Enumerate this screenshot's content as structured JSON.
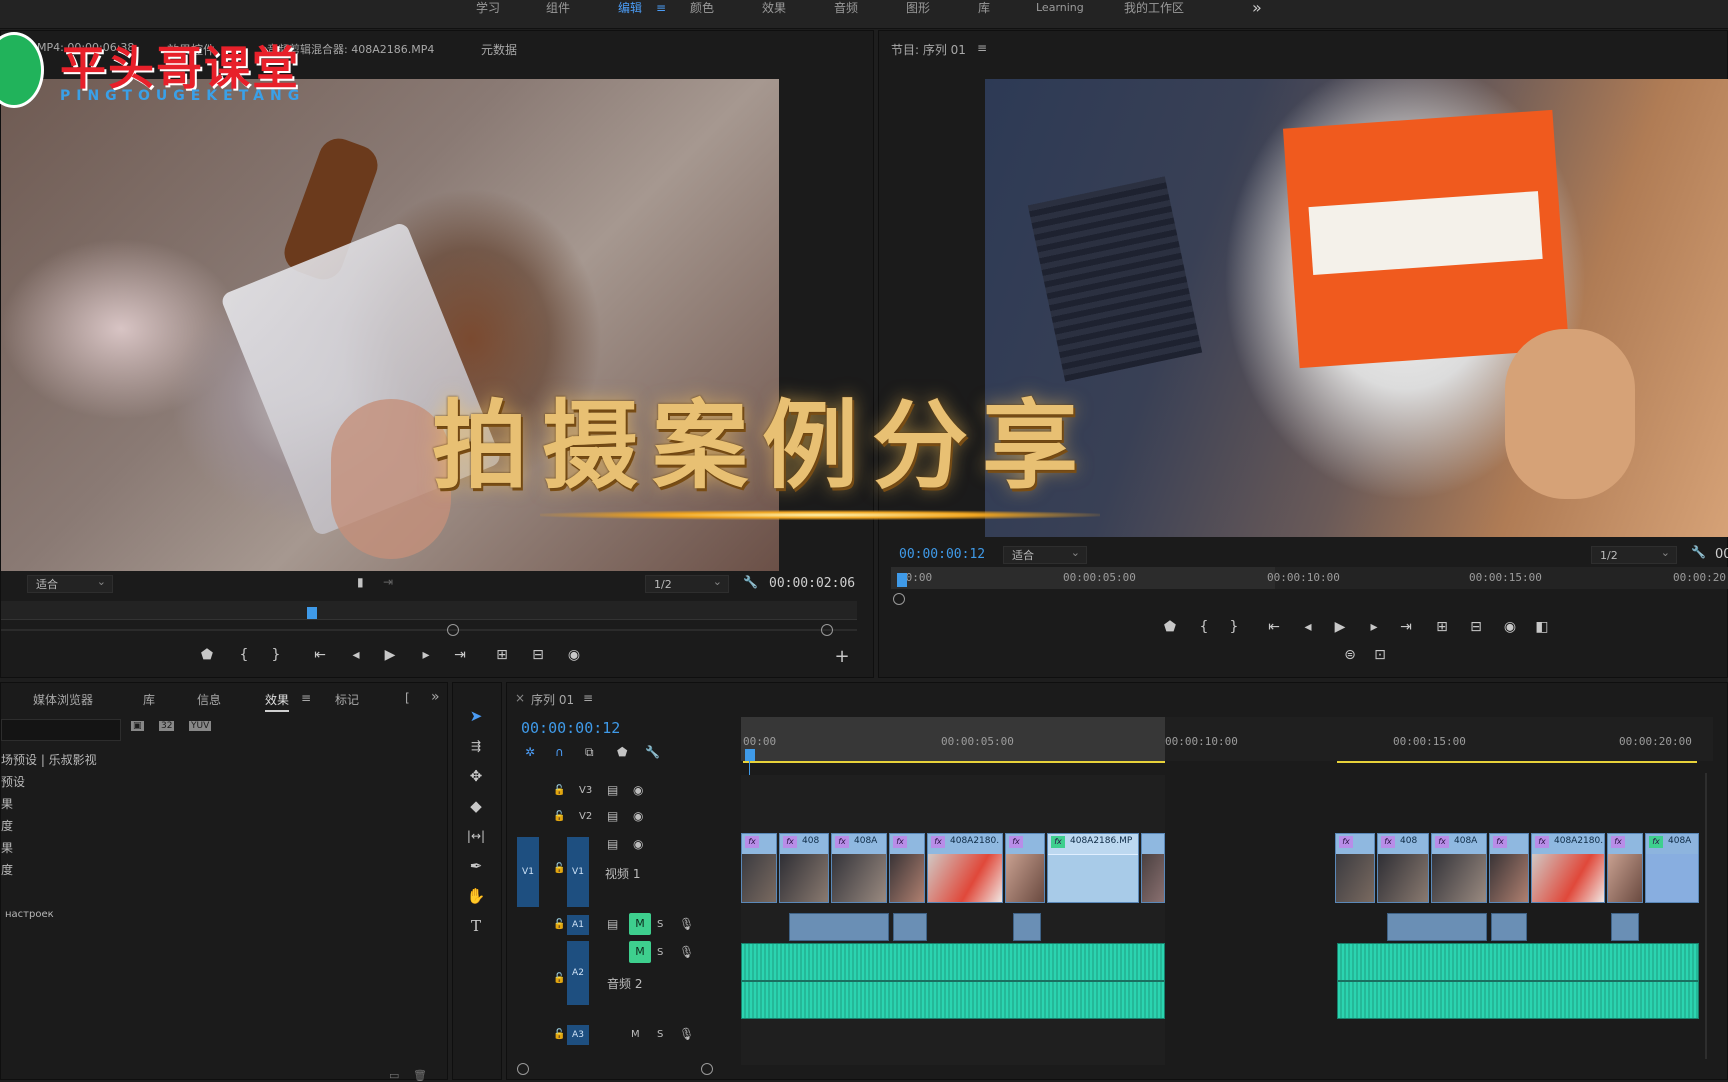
{
  "topbar": {
    "tabs": [
      "学习",
      "组件",
      "编辑",
      "颜色",
      "效果",
      "音频",
      "图形",
      "库",
      "Learning",
      "我的工作区"
    ],
    "active_index": 2,
    "overflow": "»"
  },
  "watermark": {
    "title": "平头哥课堂",
    "subtitle": "PINGTOUGEKETANG"
  },
  "source_monitor": {
    "tab_clip": "MP4: 00:00:06:38",
    "tab_effects": "效果控件",
    "tab_audio_mixer": "音频剪辑混合器: 408A2186.MP4",
    "tab_metadata": "元数据",
    "fit": "适合",
    "resolution": "1/2",
    "duration": "00:00:02:06"
  },
  "program_monitor": {
    "title": "节目: 序列 01",
    "timecode": "00:00:00:12",
    "fit": "适合",
    "resolution": "1/2",
    "duration_partial": "00",
    "ruler": [
      "00:00",
      "00:00:05:00",
      "00:00:10:00",
      "00:00:15:00",
      "00:00:20:0"
    ]
  },
  "overlay_title": "拍摄案例分享",
  "project_panel": {
    "tabs": [
      "媒体浏览器",
      "库",
      "信息",
      "效果",
      "标记"
    ],
    "active_tab": "效果",
    "tree": [
      "场预设 | 乐叔影视",
      "预设",
      "果",
      "度",
      "果",
      "度",
      "",
      "настроек"
    ]
  },
  "timeline": {
    "sequence": "序列 01",
    "timecode": "00:00:00:12",
    "ruler": [
      "00:00",
      "00:00:05:00",
      "00:00:10:00",
      "00:00:15:00",
      "00:00:20:00"
    ],
    "tracks": {
      "v3": "V3",
      "v2": "V2",
      "v1": "V1",
      "v1_name": "视频 1",
      "a1": "A1",
      "a2": "A2",
      "a2_name": "音频 2",
      "a3": "A3",
      "m": "M",
      "s": "S"
    },
    "clips_v1_left": [
      "408",
      "408A",
      "408A2180.",
      "408A2186.MP"
    ],
    "clips_v1_right": [
      "408",
      "408A",
      "408A2180.",
      "408A"
    ]
  },
  "colors": {
    "accent_blue": "#3f9ae8",
    "audio_green": "#2bbfa0",
    "clip_blue": "#8fb8e0",
    "watermark_red": "#e8202a"
  }
}
